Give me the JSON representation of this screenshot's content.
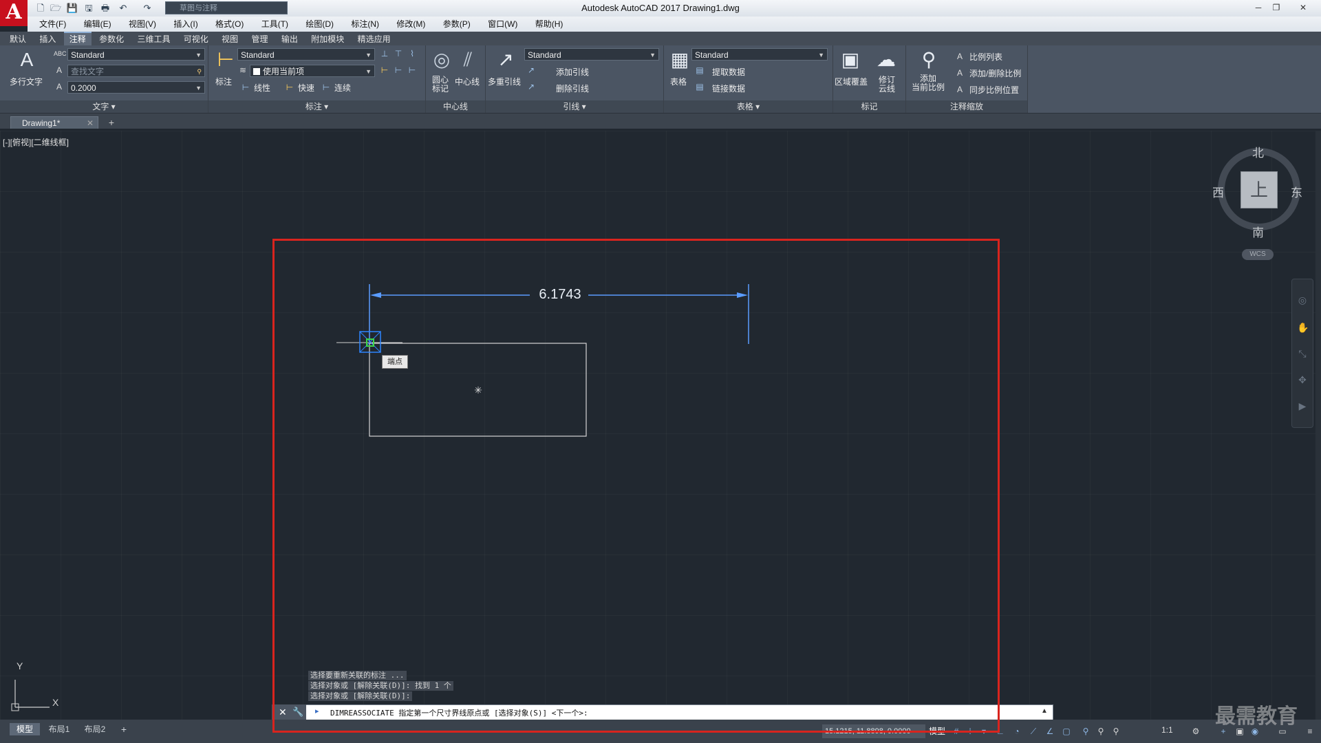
{
  "window": {
    "app_title": "Autodesk AutoCAD 2017    Drawing1.dwg",
    "logo_letter": "A",
    "workspace": "草图与注释",
    "controls": [
      "─",
      "❐",
      "✕"
    ]
  },
  "quick_access": [
    "🗋",
    "🗁",
    "💾",
    "🖫",
    "🖶",
    "↶",
    "↷"
  ],
  "menu": [
    "文件(F)",
    "编辑(E)",
    "视图(V)",
    "插入(I)",
    "格式(O)",
    "工具(T)",
    "绘图(D)",
    "标注(N)",
    "修改(M)",
    "参数(P)",
    "窗口(W)",
    "帮助(H)"
  ],
  "ribbon_tabs": [
    "默认",
    "插入",
    "注释",
    "参数化",
    "三维工具",
    "可视化",
    "视图",
    "管理",
    "输出",
    "附加模块",
    "精选应用"
  ],
  "ribbon_active_tab": "注释",
  "ribbon": {
    "text_panel": {
      "title": "文字",
      "big_label": "多行文字",
      "style": "Standard",
      "find_placeholder": "查找文字",
      "height": "0.2000"
    },
    "dim_panel": {
      "title": "标注",
      "big_label": "标注",
      "style": "Standard",
      "layer": "使用当前项",
      "linear": "线性",
      "quick": "快速",
      "continue": "连续"
    },
    "center_panel": {
      "title": "中心线",
      "center_mark": "圆心\n标记",
      "centerline": "中心线"
    },
    "leader_panel": {
      "title": "引线",
      "big_label": "多重引线",
      "style": "Standard",
      "add": "添加引线",
      "remove": "删除引线"
    },
    "table_panel": {
      "title": "表格",
      "big_label": "表格",
      "style": "Standard",
      "extract": "提取数据",
      "link": "链接数据"
    },
    "markup_panel": {
      "title": "标记",
      "wipeout": "区域覆盖",
      "revcloud": "修订\n云线"
    },
    "scale_panel": {
      "title": "注释缩放",
      "add_scale": "添加\n当前比例",
      "scale_list": "比例列表",
      "add_delete": "添加/删除比例",
      "sync": "同步比例位置"
    }
  },
  "file_tab": "Drawing1*",
  "view_label": "[-][俯视][二维线框]",
  "compass": {
    "north": "北",
    "south": "南",
    "east": "东",
    "west": "西",
    "face": "上",
    "wcs": "WCS"
  },
  "drawing": {
    "dimension_value": "6.1743",
    "snap_tooltip": "端点",
    "ucs_x": "X",
    "ucs_y": "Y"
  },
  "command": {
    "history": [
      "选择要重新关联的标注 ...",
      "选择对象或 [解除关联(D)]: 找到 1 个",
      "选择对象或 [解除关联(D)]:"
    ],
    "prompt": "DIMREASSOCIATE 指定第一个尺寸界线原点或 [选择对象(S)] <下一个>:"
  },
  "layout_tabs": [
    "模型",
    "布局1",
    "布局2"
  ],
  "status": {
    "coords": "15.1215, 11.8898, 0.0000",
    "model": "模型",
    "scale": "1:1"
  },
  "watermark": "最需教育"
}
